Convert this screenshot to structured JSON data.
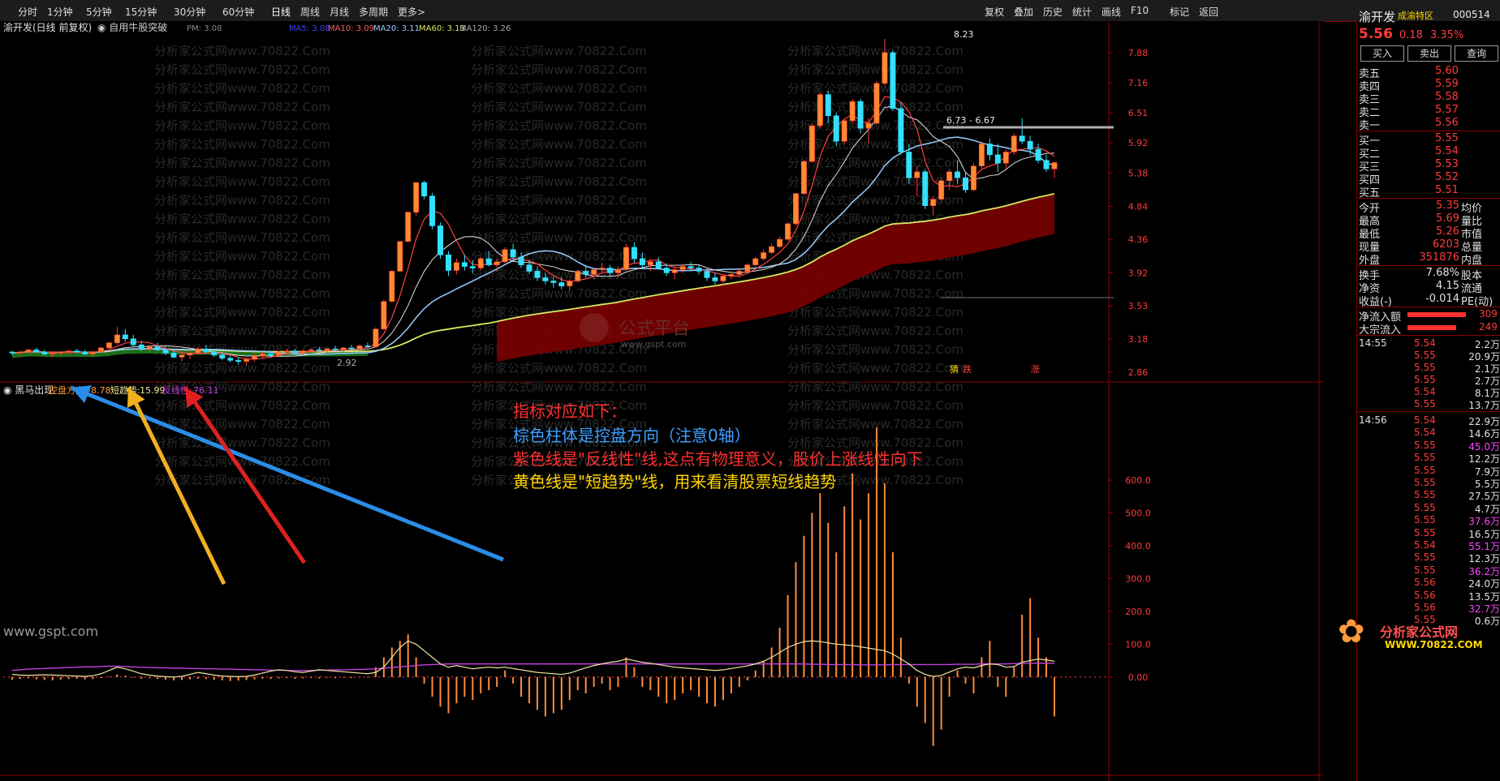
{
  "toolbar": {
    "left": [
      "分时",
      "1分钟",
      "5分钟",
      "15分钟",
      "30分钟",
      "60分钟",
      "日线",
      "周线",
      "月线",
      "多周期",
      "更多>"
    ],
    "right": [
      "复权",
      "叠加",
      "历史",
      "统计",
      "画线",
      "F10",
      "标记",
      "返回"
    ]
  },
  "chart_header": {
    "stock": "渝开发(日线 前复权)",
    "formula": "自用牛股突破",
    "pm_label": "PM: 3.08",
    "pm_value": "3.08",
    "ma5": "MA5: 3.08",
    "ma10": "MA10: 3.09",
    "ma20": "MA20: 3.11",
    "ma60": "MA60: 3.13",
    "ma120": "MA120: 3.26"
  },
  "price_axis": [
    "7.88",
    "7.16",
    "6.51",
    "5.92",
    "5.38",
    "4.84",
    "4.36",
    "3.92",
    "3.53",
    "3.18",
    "2.86"
  ],
  "price_annotations": {
    "high": "8.23",
    "range": "6.73 - 6.67",
    "low": "2.92",
    "markers": [
      "猜",
      "跌",
      "涨"
    ]
  },
  "indicator_header": {
    "name": "黑马出现",
    "kp_label": "控盘方向:",
    "kp_value": "-8.78",
    "dqs_label": "短趋势:",
    "dqs_value": "15.99",
    "fxx_label": "反线性:",
    "fxx_value": "78.11"
  },
  "indicator_axis": [
    "600.0",
    "500.0",
    "400.0",
    "300.0",
    "200.0",
    "100.0",
    "0.00"
  ],
  "annotation_text": {
    "line1": "指标对应如下：",
    "line2": "棕色柱体是控盘方向（注意0轴）",
    "line3": "紫色线是\"反线性\"线,这点有物理意义，股价上涨线性向下",
    "line4": "黄色线是\"短趋势\"线，用来看清股票短线趋势"
  },
  "watermark": {
    "center_logo": "公式平台",
    "center_url": "www.gspt.com",
    "left_bottom": "www.gspt.com",
    "brand": "分析家公式网",
    "brand_url": "WWW.70822.COM",
    "tile": "分析家公式网www.70822.Com"
  },
  "quote_panel": {
    "name": "渝开发",
    "tag": "成渝特区",
    "code": "000514",
    "price": "5.56",
    "change": "0.18",
    "pct": "3.35%",
    "buttons": [
      "买入",
      "卖出",
      "查询"
    ],
    "asks": [
      {
        "label": "卖五",
        "price": "5.60"
      },
      {
        "label": "卖四",
        "price": "5.59"
      },
      {
        "label": "卖三",
        "price": "5.58"
      },
      {
        "label": "卖二",
        "price": "5.57"
      },
      {
        "label": "卖一",
        "price": "5.56"
      }
    ],
    "bids": [
      {
        "label": "买一",
        "price": "5.55"
      },
      {
        "label": "买二",
        "price": "5.54"
      },
      {
        "label": "买三",
        "price": "5.53"
      },
      {
        "label": "买四",
        "price": "5.52"
      },
      {
        "label": "买五",
        "price": "5.51"
      }
    ],
    "stats": [
      {
        "l1": "今开",
        "v1": "5.35",
        "l2": "均价"
      },
      {
        "l1": "最高",
        "v1": "5.69",
        "l2": "量比"
      },
      {
        "l1": "最低",
        "v1": "5.26",
        "l2": "市值"
      },
      {
        "l1": "现量",
        "v1": "6203",
        "l2": "总量"
      },
      {
        "l1": "外盘",
        "v1": "351876",
        "l2": "内盘"
      }
    ],
    "stats2": [
      {
        "l1": "换手",
        "v1": "7.68%",
        "l2": "股本"
      },
      {
        "l1": "净资",
        "v1": "4.15",
        "l2": "流通"
      },
      {
        "l1": "收益(-)",
        "v1": "-0.014",
        "l2": "PE(动)"
      }
    ],
    "flow": [
      {
        "label": "净流入额",
        "value": "309"
      },
      {
        "label": "大宗流入",
        "value": "249"
      }
    ],
    "ticks1_time": "14:55",
    "ticks1": [
      {
        "p": "5.54",
        "v": "2.2万"
      },
      {
        "p": "5.55",
        "v": "20.9万"
      },
      {
        "p": "5.55",
        "v": "2.1万"
      },
      {
        "p": "5.55",
        "v": "2.7万"
      },
      {
        "p": "5.54",
        "v": "8.1万"
      },
      {
        "p": "5.55",
        "v": "13.7万"
      }
    ],
    "ticks2_time": "14:56",
    "ticks2": [
      {
        "p": "5.54",
        "v": "22.9万"
      },
      {
        "p": "5.54",
        "v": "14.6万"
      },
      {
        "p": "5.55",
        "v": "45.0万"
      },
      {
        "p": "5.55",
        "v": "12.2万"
      },
      {
        "p": "5.55",
        "v": "7.9万"
      },
      {
        "p": "5.55",
        "v": "5.5万"
      },
      {
        "p": "5.55",
        "v": "27.5万"
      },
      {
        "p": "5.55",
        "v": "4.7万"
      },
      {
        "p": "5.55",
        "v": "37.6万"
      },
      {
        "p": "5.55",
        "v": "16.5万"
      },
      {
        "p": "5.54",
        "v": "55.1万"
      },
      {
        "p": "5.55",
        "v": "12.3万"
      },
      {
        "p": "5.55",
        "v": "36.2万"
      },
      {
        "p": "5.56",
        "v": "24.0万"
      },
      {
        "p": "5.56",
        "v": "13.5万"
      },
      {
        "p": "5.56",
        "v": "32.7万"
      },
      {
        "p": "5.55",
        "v": "0.6万"
      }
    ]
  },
  "colors": {
    "up": "#ff3b3b",
    "down": "#33e0ff",
    "ma_red": "#ff4040",
    "ma_white": "#e0e0e0",
    "ma_blue": "#99ccff",
    "ma_yellow": "#d8e860",
    "green_band": "#1f7a1f",
    "brown_band": "#7a0000",
    "histogram": "#ff8c3a",
    "short_trend": "#f0e6a0",
    "reverse_line": "#c040e0"
  },
  "chart_data": {
    "type": "bar",
    "candles": [
      [
        3.05,
        3.06,
        3.02,
        3.04
      ],
      [
        3.04,
        3.06,
        3.01,
        3.05
      ],
      [
        3.05,
        3.08,
        3.03,
        3.07
      ],
      [
        3.07,
        3.09,
        3.04,
        3.05
      ],
      [
        3.05,
        3.07,
        3.02,
        3.03
      ],
      [
        3.03,
        3.05,
        3.0,
        3.04
      ],
      [
        3.04,
        3.06,
        3.02,
        3.05
      ],
      [
        3.05,
        3.07,
        3.03,
        3.06
      ],
      [
        3.06,
        3.08,
        3.04,
        3.05
      ],
      [
        3.05,
        3.07,
        3.02,
        3.03
      ],
      [
        3.03,
        3.06,
        3.01,
        3.05
      ],
      [
        3.05,
        3.1,
        3.04,
        3.09
      ],
      [
        3.09,
        3.15,
        3.08,
        3.14
      ],
      [
        3.14,
        3.3,
        3.12,
        3.22
      ],
      [
        3.22,
        3.28,
        3.15,
        3.18
      ],
      [
        3.18,
        3.22,
        3.1,
        3.12
      ],
      [
        3.12,
        3.16,
        3.06,
        3.08
      ],
      [
        3.08,
        3.12,
        3.04,
        3.1
      ],
      [
        3.1,
        3.14,
        3.06,
        3.07
      ],
      [
        3.07,
        3.1,
        3.02,
        3.04
      ],
      [
        3.04,
        3.07,
        2.99,
        3.0
      ],
      [
        3.0,
        3.04,
        2.96,
        3.02
      ],
      [
        3.02,
        3.06,
        2.98,
        3.04
      ],
      [
        3.04,
        3.1,
        3.02,
        3.08
      ],
      [
        3.08,
        3.12,
        3.04,
        3.05
      ],
      [
        3.05,
        3.08,
        3.0,
        3.02
      ],
      [
        3.02,
        3.05,
        2.97,
        2.99
      ],
      [
        2.99,
        3.02,
        2.95,
        2.97
      ],
      [
        2.97,
        3.0,
        2.93,
        2.96
      ],
      [
        2.96,
        3.0,
        2.92,
        2.98
      ],
      [
        2.98,
        3.03,
        2.96,
        3.01
      ],
      [
        3.01,
        3.05,
        2.99,
        3.03
      ],
      [
        3.03,
        3.06,
        3.0,
        3.02
      ],
      [
        3.02,
        3.06,
        3.0,
        3.05
      ],
      [
        3.05,
        3.08,
        3.03,
        3.06
      ],
      [
        3.06,
        3.08,
        3.03,
        3.04
      ],
      [
        3.04,
        3.07,
        3.02,
        3.06
      ],
      [
        3.06,
        3.09,
        3.04,
        3.07
      ],
      [
        3.07,
        3.1,
        3.05,
        3.06
      ],
      [
        3.06,
        3.09,
        3.04,
        3.08
      ],
      [
        3.08,
        3.11,
        3.06,
        3.07
      ],
      [
        3.07,
        3.1,
        3.05,
        3.09
      ],
      [
        3.09,
        3.12,
        3.07,
        3.08
      ],
      [
        3.08,
        3.12,
        3.06,
        3.11
      ],
      [
        3.11,
        3.14,
        3.09,
        3.1
      ],
      [
        3.1,
        3.3,
        3.09,
        3.28
      ],
      [
        3.28,
        3.6,
        3.27,
        3.58
      ],
      [
        3.58,
        3.95,
        3.57,
        3.94
      ],
      [
        3.94,
        4.34,
        3.93,
        4.33
      ],
      [
        4.33,
        4.76,
        4.32,
        4.75
      ],
      [
        4.75,
        5.22,
        4.7,
        5.22
      ],
      [
        5.22,
        5.25,
        4.95,
        5.0
      ],
      [
        5.0,
        5.05,
        4.5,
        4.55
      ],
      [
        4.55,
        4.6,
        4.1,
        4.15
      ],
      [
        4.15,
        4.2,
        3.88,
        3.95
      ],
      [
        3.95,
        4.1,
        3.9,
        4.05
      ],
      [
        4.05,
        4.15,
        3.95,
        4.0
      ],
      [
        4.0,
        4.08,
        3.92,
        3.98
      ],
      [
        3.98,
        4.12,
        3.95,
        4.1
      ],
      [
        4.1,
        4.2,
        4.0,
        4.02
      ],
      [
        4.02,
        4.1,
        3.94,
        4.06
      ],
      [
        4.06,
        4.25,
        4.04,
        4.22
      ],
      [
        4.22,
        4.3,
        4.08,
        4.12
      ],
      [
        4.12,
        4.18,
        3.98,
        4.02
      ],
      [
        4.02,
        4.08,
        3.9,
        3.94
      ],
      [
        3.94,
        4.0,
        3.82,
        3.86
      ],
      [
        3.86,
        3.92,
        3.78,
        3.82
      ],
      [
        3.82,
        3.88,
        3.74,
        3.8
      ],
      [
        3.8,
        3.86,
        3.72,
        3.76
      ],
      [
        3.76,
        3.84,
        3.7,
        3.82
      ],
      [
        3.82,
        3.96,
        3.8,
        3.94
      ],
      [
        3.94,
        4.02,
        3.86,
        3.9
      ],
      [
        3.9,
        3.98,
        3.84,
        3.96
      ],
      [
        3.96,
        4.05,
        3.92,
        3.98
      ],
      [
        3.98,
        4.02,
        3.88,
        3.92
      ],
      [
        3.92,
        4.0,
        3.86,
        3.96
      ],
      [
        3.96,
        4.3,
        3.95,
        4.25
      ],
      [
        4.25,
        4.32,
        4.05,
        4.1
      ],
      [
        4.1,
        4.18,
        3.98,
        4.02
      ],
      [
        4.02,
        4.1,
        3.94,
        4.06
      ],
      [
        4.06,
        4.12,
        3.96,
        3.98
      ],
      [
        3.98,
        4.04,
        3.88,
        3.92
      ],
      [
        3.92,
        3.98,
        3.84,
        3.96
      ],
      [
        3.96,
        4.04,
        3.92,
        4.0
      ],
      [
        4.0,
        4.06,
        3.94,
        3.98
      ],
      [
        3.98,
        4.02,
        3.9,
        3.94
      ],
      [
        3.94,
        3.98,
        3.82,
        3.86
      ],
      [
        3.86,
        3.92,
        3.78,
        3.82
      ],
      [
        3.82,
        3.9,
        3.76,
        3.88
      ],
      [
        3.88,
        3.94,
        3.84,
        3.9
      ],
      [
        3.9,
        3.96,
        3.86,
        3.94
      ],
      [
        3.94,
        4.04,
        3.92,
        4.02
      ],
      [
        4.02,
        4.12,
        4.0,
        4.1
      ],
      [
        4.1,
        4.22,
        4.08,
        4.18
      ],
      [
        4.18,
        4.3,
        4.16,
        4.26
      ],
      [
        4.26,
        4.4,
        4.24,
        4.36
      ],
      [
        4.36,
        4.6,
        4.34,
        4.58
      ],
      [
        4.58,
        5.05,
        4.56,
        5.04
      ],
      [
        5.04,
        5.6,
        5.02,
        5.58
      ],
      [
        5.58,
        6.3,
        5.56,
        6.25
      ],
      [
        6.25,
        6.95,
        6.2,
        6.9
      ],
      [
        6.9,
        6.98,
        6.3,
        6.45
      ],
      [
        6.45,
        6.52,
        5.85,
        5.95
      ],
      [
        5.95,
        6.4,
        5.9,
        6.35
      ],
      [
        6.35,
        6.8,
        6.3,
        6.75
      ],
      [
        6.75,
        6.8,
        6.1,
        6.2
      ],
      [
        6.2,
        6.4,
        5.9,
        6.3
      ],
      [
        6.3,
        7.2,
        6.28,
        7.15
      ],
      [
        7.15,
        8.23,
        7.1,
        7.88
      ],
      [
        7.88,
        7.95,
        6.55,
        6.6
      ],
      [
        6.6,
        6.73,
        5.7,
        5.75
      ],
      [
        5.75,
        5.9,
        5.2,
        5.3
      ],
      [
        5.3,
        5.5,
        5.0,
        5.4
      ],
      [
        5.4,
        5.45,
        4.8,
        4.85
      ],
      [
        4.85,
        5.0,
        4.7,
        4.95
      ],
      [
        4.95,
        5.3,
        4.9,
        5.25
      ],
      [
        5.25,
        5.45,
        5.1,
        5.4
      ],
      [
        5.4,
        5.6,
        5.2,
        5.3
      ],
      [
        5.3,
        5.4,
        5.05,
        5.1
      ],
      [
        5.1,
        5.55,
        5.08,
        5.5
      ],
      [
        5.5,
        5.95,
        5.45,
        5.9
      ],
      [
        5.9,
        6.0,
        5.6,
        5.7
      ],
      [
        5.7,
        5.9,
        5.4,
        5.55
      ],
      [
        5.55,
        5.8,
        5.45,
        5.75
      ],
      [
        5.75,
        6.1,
        5.7,
        6.05
      ],
      [
        6.05,
        6.4,
        5.9,
        5.95
      ],
      [
        5.95,
        6.05,
        5.7,
        5.8
      ],
      [
        5.8,
        5.9,
        5.55,
        5.6
      ],
      [
        5.6,
        5.7,
        5.4,
        5.45
      ],
      [
        5.45,
        5.58,
        5.3,
        5.56
      ]
    ],
    "histogram": [
      -8,
      -6,
      -4,
      -7,
      -9,
      -10,
      -8,
      -6,
      -5,
      -7,
      -6,
      -3,
      2,
      8,
      4,
      -2,
      -5,
      -3,
      -6,
      -8,
      -10,
      -9,
      -7,
      -5,
      -6,
      -8,
      -10,
      -12,
      -11,
      -9,
      -7,
      -5,
      -6,
      -4,
      -3,
      -5,
      -4,
      -3,
      -4,
      -2,
      -3,
      -2,
      -3,
      -1,
      -2,
      30,
      60,
      90,
      110,
      130,
      60,
      -20,
      -60,
      -90,
      -110,
      -80,
      -60,
      -70,
      -50,
      -40,
      -30,
      20,
      -20,
      -60,
      -80,
      -100,
      -120,
      -110,
      -100,
      -70,
      -40,
      -50,
      -30,
      -20,
      -40,
      -30,
      60,
      30,
      -30,
      -40,
      -60,
      -80,
      -70,
      -50,
      -40,
      -60,
      -80,
      -90,
      -70,
      -50,
      -30,
      -10,
      20,
      50,
      90,
      150,
      250,
      350,
      430,
      500,
      560,
      470,
      380,
      520,
      620,
      480,
      560,
      760,
      590,
      380,
      120,
      -20,
      -90,
      -140,
      -210,
      -160,
      -60,
      20,
      -20,
      -50,
      60,
      110,
      -30,
      -60,
      30,
      190,
      240,
      120,
      60,
      -120
    ],
    "short_trend": [
      8,
      6,
      5,
      6,
      7,
      6,
      5,
      4,
      3,
      2,
      4,
      10,
      20,
      30,
      25,
      18,
      10,
      6,
      3,
      1,
      0,
      2,
      8,
      14,
      10,
      6,
      3,
      2,
      1,
      2,
      6,
      12,
      18,
      22,
      20,
      16,
      14,
      18,
      22,
      20,
      18,
      16,
      14,
      12,
      10,
      14,
      30,
      60,
      90,
      110,
      100,
      80,
      60,
      40,
      30,
      35,
      30,
      25,
      28,
      30,
      28,
      30,
      26,
      22,
      18,
      14,
      12,
      10,
      8,
      12,
      20,
      28,
      35,
      40,
      45,
      48,
      55,
      50,
      45,
      42,
      38,
      34,
      30,
      28,
      26,
      24,
      22,
      20,
      22,
      26,
      30,
      34,
      40,
      48,
      60,
      75,
      90,
      100,
      108,
      110,
      108,
      104,
      100,
      98,
      96,
      92,
      88,
      84,
      80,
      70,
      55,
      40,
      20,
      8,
      2,
      5,
      15,
      25,
      30,
      28,
      35,
      40,
      38,
      30,
      32,
      45,
      50,
      55,
      52,
      48
    ],
    "reverse_line": [
      20,
      22,
      24,
      25,
      26,
      27,
      28,
      29,
      30,
      31,
      31,
      32,
      33,
      33,
      32,
      31,
      30,
      29,
      28,
      28,
      27,
      27,
      26,
      26,
      25,
      25,
      24,
      24,
      23,
      23,
      22,
      22,
      21,
      21,
      20,
      20,
      20,
      20,
      21,
      21,
      22,
      22,
      23,
      23,
      24,
      25,
      27,
      29,
      31,
      33,
      35,
      37,
      38,
      39,
      40,
      40,
      40,
      40,
      40,
      40,
      40,
      40,
      40,
      40,
      40,
      40,
      40,
      40,
      40,
      40,
      40,
      40,
      40,
      40,
      40,
      40,
      40,
      40,
      40,
      40,
      40,
      40,
      40,
      40,
      40,
      40,
      40,
      40,
      40,
      40,
      40,
      40,
      40,
      40,
      40,
      40,
      40,
      40,
      40,
      39,
      39,
      38,
      38,
      38,
      38,
      37,
      37,
      37,
      37,
      38,
      38,
      38,
      38,
      38,
      38,
      38,
      38,
      39,
      39,
      39,
      40,
      40,
      40,
      40,
      41,
      41,
      42,
      42,
      42,
      42
    ],
    "ylim_price": [
      2.86,
      8.23
    ],
    "ylim_indicator": [
      -250,
      800
    ]
  }
}
